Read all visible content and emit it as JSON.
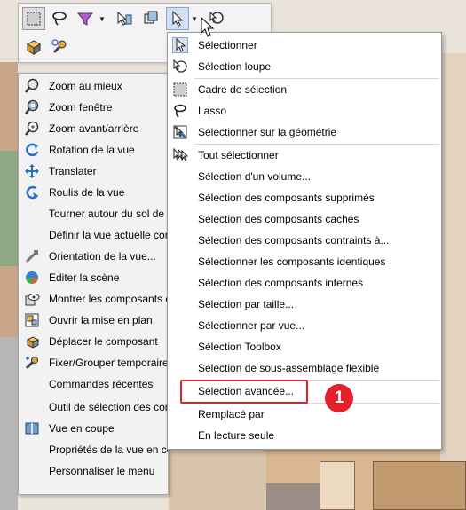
{
  "toolbar": {
    "buttons": [
      "select-box-icon",
      "lasso-icon",
      "filter-icon",
      "filter-dropdown-icon",
      "select-other-icon",
      "view-orientation-icon",
      "pointer-icon",
      "pointer-dropdown-icon",
      "magnify-select-icon",
      "shaded-box-icon",
      "wrench-icon"
    ]
  },
  "context_menu": {
    "items": [
      {
        "label": "Zoom au mieux",
        "icon": "zoom-fit-icon"
      },
      {
        "label": "Zoom fenêtre",
        "icon": "zoom-window-icon"
      },
      {
        "label": "Zoom avant/arrière",
        "icon": "zoom-in-out-icon"
      },
      {
        "label": "Rotation de la vue",
        "icon": "rotate-view-icon"
      },
      {
        "label": "Translater",
        "icon": "pan-icon"
      },
      {
        "label": "Roulis de la vue",
        "icon": "roll-view-icon"
      },
      {
        "label": "Tourner autour du sol de l",
        "icon": ""
      },
      {
        "label": "Définir la vue actuelle com",
        "icon": ""
      },
      {
        "label": "Orientation de la vue...",
        "icon": "view-orientation-icon"
      },
      {
        "label": "Editer la scène",
        "icon": "edit-scene-icon"
      },
      {
        "label": "Montrer les composants ca",
        "icon": "show-components-icon"
      },
      {
        "label": "Ouvrir la mise en plan",
        "icon": "open-drawing-icon"
      },
      {
        "label": "Déplacer le composant",
        "icon": "move-component-icon"
      },
      {
        "label": "Fixer/Grouper temporaire",
        "icon": "fix-group-icon"
      },
      {
        "label": "Commandes récentes",
        "icon": ""
      },
      {
        "label": "Outil de sélection des com",
        "icon": ""
      },
      {
        "label": "Vue en coupe",
        "icon": "section-view-icon"
      },
      {
        "label": "Propriétés de la vue en coupe...",
        "icon": ""
      },
      {
        "label": "Personnaliser le menu",
        "icon": ""
      }
    ]
  },
  "dropdown_menu": {
    "items": [
      {
        "label": "Sélectionner",
        "icon": "pointer-icon"
      },
      {
        "label": "Sélection loupe",
        "icon": "magnify-select-icon"
      },
      {
        "label": "Cadre de sélection",
        "icon": "box-select-icon"
      },
      {
        "label": "Lasso",
        "icon": "lasso-icon"
      },
      {
        "label": "Sélectionner sur la géométrie",
        "icon": "geometry-select-icon"
      },
      {
        "label": "Tout sélectionner",
        "icon": "select-all-icon"
      },
      {
        "label": "Sélection d'un volume...",
        "icon": ""
      },
      {
        "label": "Sélection des composants supprimés",
        "icon": ""
      },
      {
        "label": "Sélection des composants cachés",
        "icon": ""
      },
      {
        "label": "Sélection des composants contraints à...",
        "icon": ""
      },
      {
        "label": "Sélectionner les composants identiques",
        "icon": ""
      },
      {
        "label": "Sélection des composants internes",
        "icon": ""
      },
      {
        "label": "Sélection par taille...",
        "icon": ""
      },
      {
        "label": "Sélectionner par vue...",
        "icon": ""
      },
      {
        "label": "Sélection Toolbox",
        "icon": ""
      },
      {
        "label": "Sélection de sous-assemblage flexible",
        "icon": ""
      },
      {
        "label": "Sélection avancée...",
        "icon": ""
      },
      {
        "label": "Remplacé par",
        "icon": ""
      },
      {
        "label": "En lecture seule",
        "icon": ""
      }
    ]
  },
  "annotation": {
    "badge_number": "1",
    "highlight_color": "#e4202a"
  },
  "colors": {
    "menu_bg": "#ffffff",
    "context_bg": "#f2f2f2",
    "toolbar_bg": "#f3f3f3",
    "accent": "#e4202a"
  }
}
